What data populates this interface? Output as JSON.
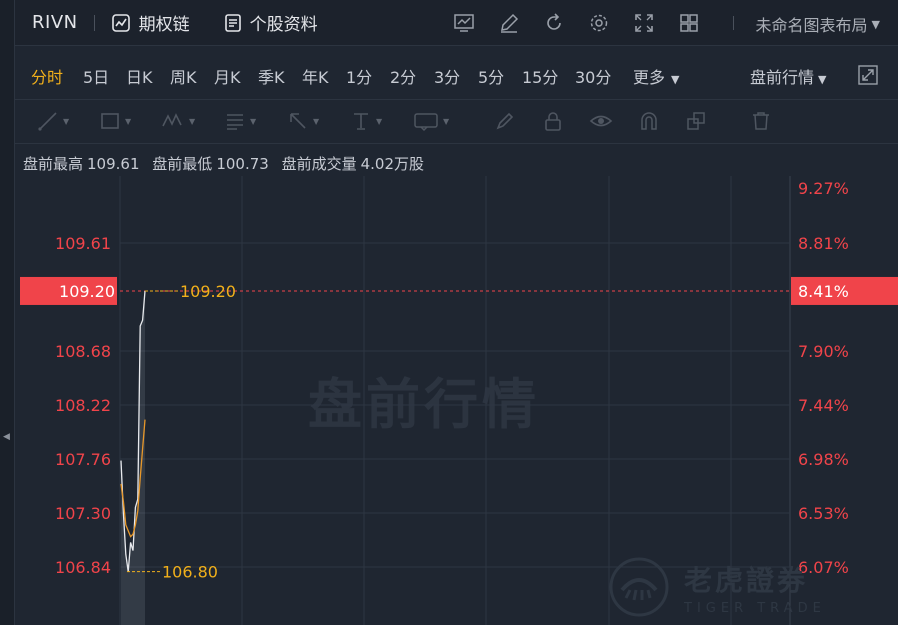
{
  "topbar": {
    "ticker": "RIVN",
    "option_chain": "期权链",
    "stock_info": "个股资料",
    "layout_name": "未命名图表布局"
  },
  "periods": [
    {
      "label": "分时",
      "active": true
    },
    {
      "label": "5日"
    },
    {
      "label": "日K"
    },
    {
      "label": "周K"
    },
    {
      "label": "月K"
    },
    {
      "label": "季K"
    },
    {
      "label": "年K"
    },
    {
      "label": "1分"
    },
    {
      "label": "2分"
    },
    {
      "label": "3分"
    },
    {
      "label": "5分"
    },
    {
      "label": "15分"
    },
    {
      "label": "30分"
    },
    {
      "label": "更多"
    }
  ],
  "session_selector": "盘前行情",
  "info": {
    "high_label": "盘前最高",
    "high_value": "109.61",
    "low_label": "盘前最低",
    "low_value": "100.73",
    "volume_label": "盘前成交量",
    "volume_value": "4.02万股"
  },
  "watermark": "盘前行情",
  "brand": {
    "cn": "老虎證券",
    "en": "TIGER TRADE"
  },
  "colors": {
    "accent": "#f1b01b",
    "up": "#f0444a",
    "price_line": "#e8eaee",
    "avg_line": "#e8982a"
  },
  "chart_data": {
    "type": "line",
    "y_left_ticks": [
      "109.61",
      "108.68",
      "108.22",
      "107.76",
      "107.30",
      "106.84"
    ],
    "y_right_ticks": [
      "9.27%",
      "8.81%",
      "8.41%",
      "7.90%",
      "7.44%",
      "6.98%",
      "6.53%",
      "6.07%"
    ],
    "current_price": "109.20",
    "current_change": "8.41%",
    "high_marker": "109.20",
    "low_marker": "106.80",
    "ylim": [
      106.6,
      110.0
    ],
    "series": [
      {
        "values": [
          107.75,
          107.3,
          106.95,
          106.8,
          107.05,
          106.98,
          107.35,
          107.42,
          108.9,
          108.95,
          109.2
        ]
      },
      {
        "values": [
          107.55,
          107.4,
          107.2,
          107.15,
          107.1,
          107.12,
          107.2,
          107.32,
          107.6,
          107.85,
          108.1
        ]
      }
    ]
  }
}
